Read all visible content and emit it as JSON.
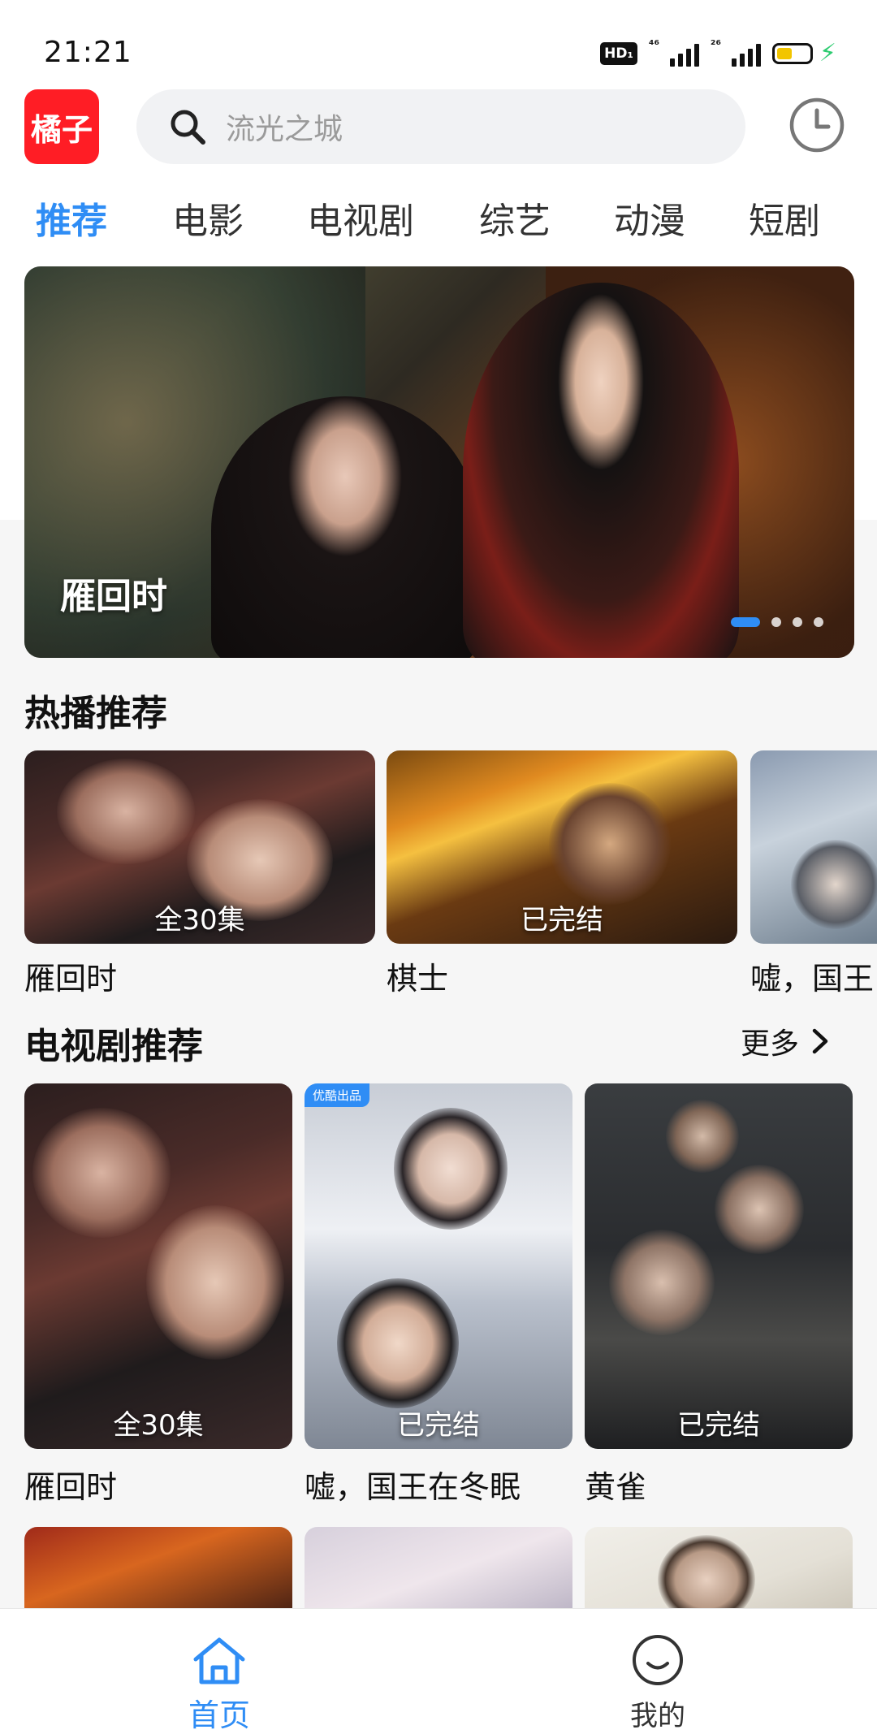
{
  "status_bar": {
    "time": "21:21",
    "hd_badge": "HD₁",
    "signal1_label": "⁴⁶",
    "signal2_label": "²⁶"
  },
  "header": {
    "app_logo": "橘子",
    "search_placeholder": "流光之城"
  },
  "tabs": [
    {
      "label": "推荐",
      "active": true
    },
    {
      "label": "电影",
      "active": false
    },
    {
      "label": "电视剧",
      "active": false
    },
    {
      "label": "综艺",
      "active": false
    },
    {
      "label": "动漫",
      "active": false
    },
    {
      "label": "短剧",
      "active": false
    }
  ],
  "banner": {
    "title": "雁回时",
    "page_count": 4,
    "active_page": 1
  },
  "hot_section": {
    "title": "热播推荐",
    "items": [
      {
        "title": "雁回时",
        "badge": "全30集"
      },
      {
        "title": "棋士",
        "badge": "已完结"
      },
      {
        "title": "嘘，国王",
        "badge": ""
      }
    ]
  },
  "tv_section": {
    "title": "电视剧推荐",
    "more_label": "更多",
    "items": [
      {
        "title": "雁回时",
        "badge": "全30集",
        "tag": ""
      },
      {
        "title": "嘘，国王在冬眠",
        "badge": "已完结",
        "tag": "优酷出品"
      },
      {
        "title": "黄雀",
        "badge": "已完结",
        "tag": ""
      }
    ]
  },
  "bottom_nav": [
    {
      "label": "首页",
      "active": true
    },
    {
      "label": "我的",
      "active": false
    }
  ],
  "colors": {
    "accent": "#2f8df5",
    "logo_red": "#ff1d25",
    "search_bg": "#f1f2f4"
  }
}
